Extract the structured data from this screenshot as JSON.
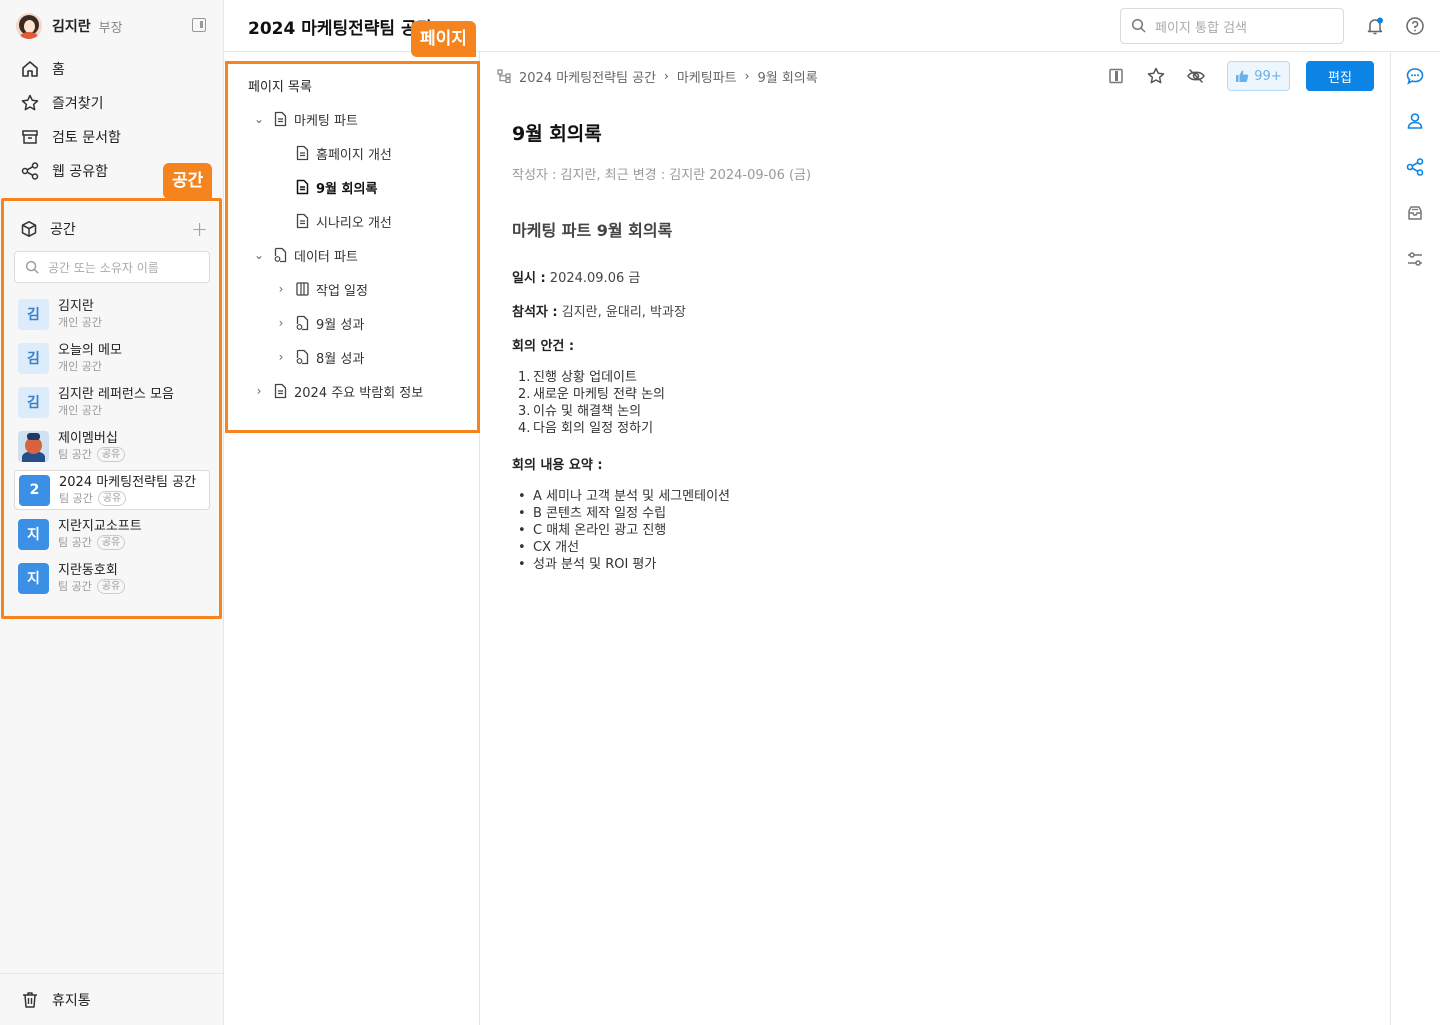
{
  "user": {
    "name": "김지란",
    "role": "부장"
  },
  "nav": {
    "home": "홈",
    "favorites": "즐겨찾기",
    "review": "검토 문서함",
    "web_share": "웹 공유함",
    "trash": "휴지통"
  },
  "annotations": {
    "space_tag": "공간",
    "page_tag": "페이지"
  },
  "spaces": {
    "title": "공간",
    "search_placeholder": "공간 또는 소유자 이름",
    "items": [
      {
        "initial": "김",
        "name": "김지란",
        "type": "개인 공간",
        "badge": ""
      },
      {
        "initial": "김",
        "name": "오늘의 메모",
        "type": "개인 공간",
        "badge": ""
      },
      {
        "initial": "김",
        "name": "김지란 레퍼런스 모음",
        "type": "개인 공간",
        "badge": ""
      },
      {
        "initial": "",
        "name": "제이멤버십",
        "type": "팀 공간",
        "badge": "공유"
      },
      {
        "initial": "2",
        "name": "2024 마케팅전략팀 공간",
        "type": "팀 공간",
        "badge": "공유"
      },
      {
        "initial": "지",
        "name": "지란지교소프트",
        "type": "팀 공간",
        "badge": "공유"
      },
      {
        "initial": "지",
        "name": "지란동호회",
        "type": "팀 공간",
        "badge": "공유"
      }
    ]
  },
  "header": {
    "space_title": "2024 마케팅전략팀 공간",
    "search_placeholder": "페이지 통합 검색"
  },
  "page_tree": {
    "title": "페이지 목록",
    "items": [
      {
        "label": "마케팅 파트"
      },
      {
        "label": "홈페이지 개선"
      },
      {
        "label": "9월 회의록"
      },
      {
        "label": "시나리오 개선"
      },
      {
        "label": "데이터 파트"
      },
      {
        "label": "작업 일정"
      },
      {
        "label": "9월 성과"
      },
      {
        "label": "8월 성과"
      },
      {
        "label": "2024 주요 박람회 정보"
      }
    ]
  },
  "breadcrumb": [
    "2024 마케팅전략팀 공간",
    "마케팅파트",
    "9월 회의록"
  ],
  "toolbar": {
    "like_count": "99+",
    "edit_label": "편집"
  },
  "document": {
    "title": "9월 회의록",
    "meta": "작성자 : 김지란,  최근 변경 : 김지란  2024-09-06 (금)",
    "heading": "마케팅 파트 9월 회의록",
    "date_label": "일시 :",
    "date_value": "2024.09.06 금",
    "attendees_label": "참석자 :",
    "attendees_value": "김지란, 윤대리, 박과장",
    "agenda_label": "회의 안건 :",
    "agenda": [
      "진행 상황 업데이트",
      "새로운 마케팅 전략 논의",
      "이슈 및 해결책 논의",
      "다음 회의 일정 정하기"
    ],
    "summary_label": "회의 내용 요약 :",
    "summary": [
      "A 세미나 고객 분석 및 세그멘테이션",
      "B 콘텐츠 제작 일정 수립",
      "C 매체 온라인 광고 진행",
      "CX 개선",
      "성과 분석 및 ROI 평가"
    ]
  },
  "colors": {
    "accent": "#0b84e6",
    "annotation": "#f5841f"
  }
}
